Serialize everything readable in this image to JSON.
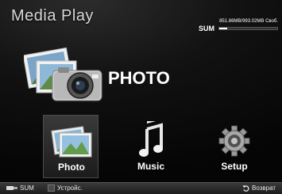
{
  "app": {
    "title": "Media Play"
  },
  "storage": {
    "device": "SUM",
    "usage": "851.86MB/993.02MB Своб.",
    "used_fraction": 0.14
  },
  "hero": {
    "title": "PHOTO"
  },
  "menu": {
    "items": [
      {
        "label": "Photo",
        "selected": true
      },
      {
        "label": "Music",
        "selected": false
      },
      {
        "label": "Setup",
        "selected": false
      }
    ]
  },
  "bottom_bar": {
    "sum_label": "SUM",
    "device_label": "Устройс.",
    "return_label": "Возврат"
  }
}
